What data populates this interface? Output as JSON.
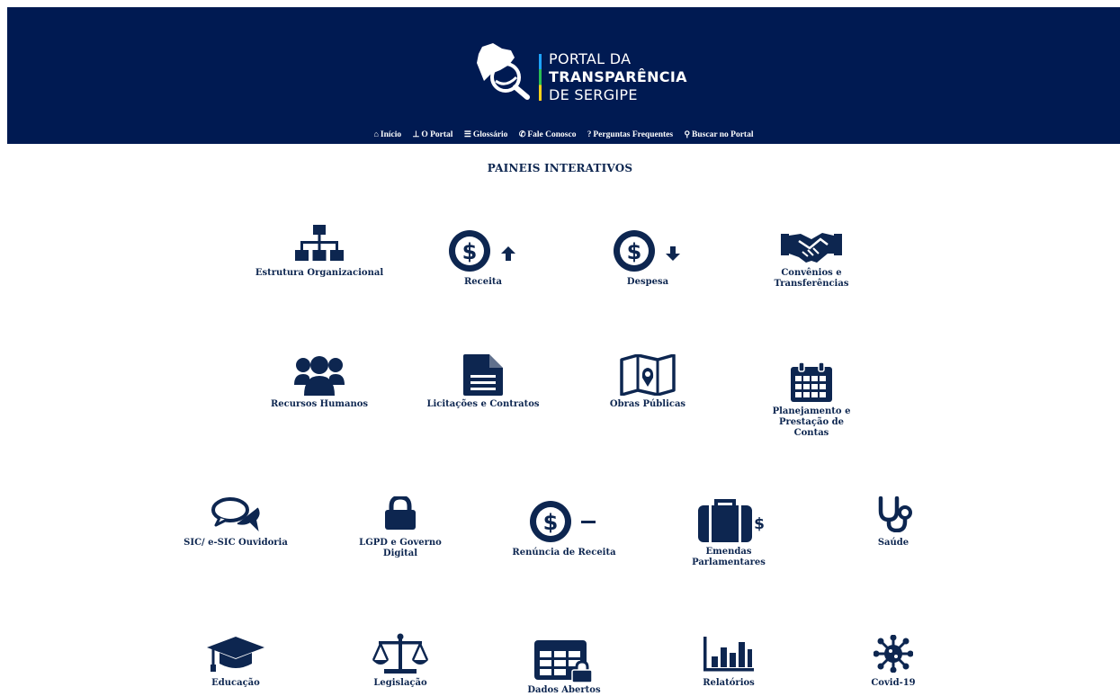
{
  "header": {
    "logo": {
      "line1": "PORTAL DA",
      "line2": "TRANSPARÊNCIA",
      "line3": "DE SERGIPE"
    },
    "nav": [
      {
        "label": "Início",
        "icon": "home-icon"
      },
      {
        "label": "O Portal",
        "icon": "sitemap-icon"
      },
      {
        "label": "Glossário",
        "icon": "list-icon"
      },
      {
        "label": "Fale Conosco",
        "icon": "phone-icon"
      },
      {
        "label": "Perguntas Frequentes",
        "icon": "question-icon"
      },
      {
        "label": "Buscar no Portal",
        "icon": "search-icon"
      }
    ]
  },
  "main": {
    "title": "PAINEIS INTERATIVOS",
    "tiles": [
      {
        "label": "Estrutura Organizacional",
        "icon": "org-chart-icon"
      },
      {
        "label": "Receita",
        "icon": "dollar-up-icon"
      },
      {
        "label": "Despesa",
        "icon": "dollar-down-icon"
      },
      {
        "label": "Convênios e Transferências",
        "icon": "handshake-icon"
      },
      {
        "label": "Recursos Humanos",
        "icon": "users-icon"
      },
      {
        "label": "Licitações e Contratos",
        "icon": "document-icon"
      },
      {
        "label": "Obras Públicas",
        "icon": "map-icon"
      },
      {
        "label": "Planejamento e Prestação de Contas",
        "icon": "calendar-icon"
      },
      {
        "label": "SIC/ e-SIC Ouvidoria",
        "icon": "chat-icon"
      },
      {
        "label": "LGPD e Governo Digital",
        "icon": "lock-icon"
      },
      {
        "label": "Renúncia de Receita",
        "icon": "dollar-minus-icon"
      },
      {
        "label": "Emendas Parlamentares",
        "icon": "briefcase-icon"
      },
      {
        "label": "Saúde",
        "icon": "stethoscope-icon"
      },
      {
        "label": "Educação",
        "icon": "graduation-cap-icon"
      },
      {
        "label": "Legislação",
        "icon": "scale-icon"
      },
      {
        "label": "Dados Abertos",
        "icon": "table-lock-icon"
      },
      {
        "label": "Relatórios",
        "icon": "bar-chart-icon"
      },
      {
        "label": "Covid-19",
        "icon": "virus-icon"
      }
    ]
  },
  "colors": {
    "header_bg": "#001a52",
    "icon": "#0d2650",
    "accent_blue": "#1ea3ff",
    "accent_green": "#2bbf54",
    "accent_yellow": "#ffd21a"
  }
}
